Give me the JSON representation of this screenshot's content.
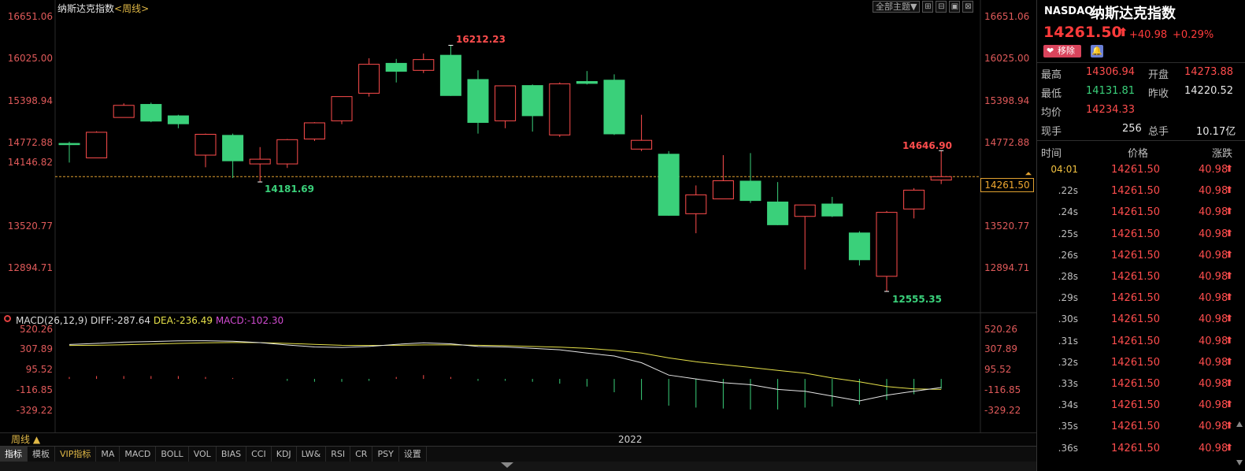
{
  "chart": {
    "title": "纳斯达克指数",
    "period_tag": "<周线>",
    "top_buttons": [
      "全部主题▼",
      "⊞",
      "⊟",
      "▣",
      "⊠"
    ],
    "y_labels": [
      "16651.06",
      "16025.00",
      "15398.94",
      "14772.88",
      "14146.82",
      "13520.77",
      "12894.71"
    ],
    "annotations": {
      "high": "16212.23",
      "low1": "14181.69",
      "recent_high": "14646.90",
      "low2": "12555.35"
    },
    "current_price_tag": "14261.50",
    "period_label": "周线 ▲",
    "year_label": "2022"
  },
  "macd": {
    "title": "MACD(26,12,9)",
    "diff": "DIFF:-287.64",
    "dea": "DEA:-236.49",
    "macd": "MACD:-102.30",
    "y_labels": [
      "520.26",
      "307.89",
      "95.52",
      "-116.85",
      "-329.22"
    ]
  },
  "tabs": [
    "指标",
    "模板",
    "VIP指标",
    "MA",
    "MACD",
    "BOLL",
    "VOL",
    "BIAS",
    "CCI",
    "KDJ",
    "LW&",
    "RSI",
    "CR",
    "PSY",
    "设置"
  ],
  "candles": [
    {
      "o": 14760,
      "c": 14730,
      "h": 14780,
      "l": 14470
    },
    {
      "o": 14540,
      "c": 14920,
      "h": 14935,
      "l": 14540
    },
    {
      "o": 15140,
      "c": 15320,
      "h": 15350,
      "l": 15140
    },
    {
      "o": 15340,
      "c": 15080,
      "h": 15360,
      "l": 15070
    },
    {
      "o": 15170,
      "c": 15040,
      "h": 15180,
      "l": 14980
    },
    {
      "o": 14580,
      "c": 14890,
      "h": 14900,
      "l": 14400
    },
    {
      "o": 14880,
      "c": 14490,
      "h": 14900,
      "l": 14240
    },
    {
      "o": 14450,
      "c": 14520,
      "h": 14700,
      "l": 14181.69
    },
    {
      "o": 14450,
      "c": 14810,
      "h": 14820,
      "l": 14390
    },
    {
      "o": 14820,
      "c": 15060,
      "h": 15070,
      "l": 14790
    },
    {
      "o": 15090,
      "c": 15450,
      "h": 15450,
      "l": 15040
    },
    {
      "o": 15500,
      "c": 15930,
      "h": 16020,
      "l": 15450
    },
    {
      "o": 15950,
      "c": 15820,
      "h": 16010,
      "l": 15660
    },
    {
      "o": 15840,
      "c": 16000,
      "h": 16090,
      "l": 15800
    },
    {
      "o": 16070,
      "c": 15460,
      "h": 16212.23,
      "l": 15460
    },
    {
      "o": 15710,
      "c": 15060,
      "h": 15840,
      "l": 14900
    },
    {
      "o": 15090,
      "c": 15610,
      "h": 15610,
      "l": 14980
    },
    {
      "o": 15620,
      "c": 15160,
      "h": 15630,
      "l": 14930
    },
    {
      "o": 14880,
      "c": 15640,
      "h": 15660,
      "l": 14850
    },
    {
      "o": 15680,
      "c": 15640,
      "h": 15830,
      "l": 15630
    },
    {
      "o": 15700,
      "c": 14890,
      "h": 15780,
      "l": 14880
    },
    {
      "o": 14670,
      "c": 14800,
      "h": 15180,
      "l": 14640
    },
    {
      "o": 14600,
      "c": 13680,
      "h": 14640,
      "l": 13680
    },
    {
      "o": 13710,
      "c": 13990,
      "h": 14130,
      "l": 13420
    },
    {
      "o": 13930,
      "c": 14200,
      "h": 14580,
      "l": 13930
    },
    {
      "o": 14200,
      "c": 13900,
      "h": 14610,
      "l": 13870
    },
    {
      "o": 13890,
      "c": 13540,
      "h": 14180,
      "l": 13540
    },
    {
      "o": 13670,
      "c": 13840,
      "h": 13840,
      "l": 12880
    },
    {
      "o": 13860,
      "c": 13670,
      "h": 13960,
      "l": 13660
    },
    {
      "o": 13430,
      "c": 13020,
      "h": 13450,
      "l": 12940
    },
    {
      "o": 12780,
      "c": 13730,
      "h": 13750,
      "l": 12555.35
    },
    {
      "o": 13780,
      "c": 14060,
      "h": 14090,
      "l": 13640
    },
    {
      "o": 14210,
      "c": 14260,
      "h": 14646.9,
      "l": 14150
    }
  ],
  "macd_series": {
    "diff": [
      360,
      372,
      385,
      392,
      398,
      400,
      395,
      380,
      355,
      335,
      330,
      340,
      362,
      378,
      368,
      340,
      335,
      320,
      305,
      270,
      240,
      170,
      40,
      0,
      -40,
      -60,
      -110,
      -130,
      -180,
      -230,
      -170,
      -130,
      -90
    ],
    "dea": [
      350,
      352,
      358,
      364,
      372,
      378,
      381,
      380,
      372,
      362,
      352,
      350,
      352,
      356,
      356,
      352,
      348,
      340,
      332,
      320,
      300,
      270,
      220,
      180,
      150,
      120,
      90,
      60,
      10,
      -30,
      -80,
      -105,
      -110
    ],
    "macd": [
      20,
      30,
      30,
      30,
      30,
      20,
      10,
      0,
      -20,
      -30,
      -30,
      -20,
      20,
      40,
      20,
      -20,
      -20,
      -30,
      -50,
      -80,
      -140,
      -220,
      -280,
      -300,
      -310,
      -320,
      -320,
      -300,
      -290,
      -270,
      -220,
      -160,
      -102.3
    ]
  },
  "side": {
    "code": "NASDAQ",
    "name": "纳斯达克指数",
    "price": "14261.50",
    "arrow": "⬆",
    "change": "+40.98",
    "pct": "+0.29%",
    "fav_label": "移除",
    "stats": [
      {
        "l1": "最高",
        "v1": "14306.94",
        "c1": "red",
        "l2": "开盘",
        "v2": "14273.88",
        "c2": "red"
      },
      {
        "l1": "最低",
        "v1": "14131.81",
        "c1": "green",
        "l2": "昨收",
        "v2": "14220.52",
        "c2": "white"
      },
      {
        "l1": "均价",
        "v1": "14234.33",
        "c1": "red",
        "l2": "",
        "v2": "",
        "c2": "white"
      },
      {
        "l1": "现手",
        "v1": "256",
        "c1": "white",
        "l2": "总手",
        "v2": "10.17亿",
        "c2": "white"
      }
    ],
    "tick_header": {
      "time": "时间",
      "price": "价格",
      "change": "涨跌"
    },
    "ticks": [
      {
        "time": "04:01",
        "price": "14261.50",
        "change": "40.98"
      },
      {
        "time": ".22s",
        "price": "14261.50",
        "change": "40.98"
      },
      {
        "time": ".24s",
        "price": "14261.50",
        "change": "40.98"
      },
      {
        "time": ".25s",
        "price": "14261.50",
        "change": "40.98"
      },
      {
        "time": ".26s",
        "price": "14261.50",
        "change": "40.98"
      },
      {
        "time": ".28s",
        "price": "14261.50",
        "change": "40.98"
      },
      {
        "time": ".29s",
        "price": "14261.50",
        "change": "40.98"
      },
      {
        "time": ".30s",
        "price": "14261.50",
        "change": "40.98"
      },
      {
        "time": ".31s",
        "price": "14261.50",
        "change": "40.98"
      },
      {
        "time": ".32s",
        "price": "14261.50",
        "change": "40.98"
      },
      {
        "time": ".33s",
        "price": "14261.50",
        "change": "40.98"
      },
      {
        "time": ".34s",
        "price": "14261.50",
        "change": "40.98"
      },
      {
        "time": ".35s",
        "price": "14261.50",
        "change": "40.98"
      },
      {
        "time": ".36s",
        "price": "14261.50",
        "change": "40.98"
      }
    ]
  },
  "colors": {
    "up": "#ff4d4d",
    "down": "#3ad07a",
    "dea": "#e6e14a",
    "diff": "#e6e6e6",
    "price_line": "#e0a030"
  }
}
